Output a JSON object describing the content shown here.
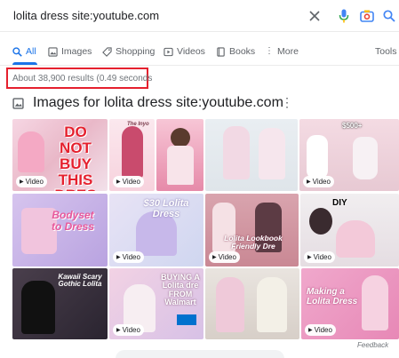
{
  "search": {
    "query": "lolita dress site:youtube.com"
  },
  "tabs": [
    {
      "label": "All",
      "icon": "search-icon",
      "active": true
    },
    {
      "label": "Images",
      "icon": "image-icon",
      "active": false
    },
    {
      "label": "Shopping",
      "icon": "tag-icon",
      "active": false
    },
    {
      "label": "Videos",
      "icon": "video-icon",
      "active": false
    },
    {
      "label": "Books",
      "icon": "book-icon",
      "active": false
    },
    {
      "label": "More",
      "icon": "kebab-icon",
      "active": false
    }
  ],
  "tools_label": "Tools",
  "result_stats": "About 38,900 results (0.49 seconds",
  "images_section": {
    "title": "Images for lolita dress site:youtube.com",
    "more_glyph": "⋮",
    "video_badge": "Video",
    "thumbnails": [
      {
        "text": "DO NOT BUY THIS DRES",
        "badge": true
      },
      {
        "text": "The Inyo",
        "badge": true
      },
      {
        "text": "",
        "badge": false
      },
      {
        "text": "",
        "badge": false
      },
      {
        "text": "$500+",
        "badge": true
      },
      {
        "text": "Bodyset to Dress",
        "badge": false
      },
      {
        "text": "$30 Lolita Dress",
        "badge": true
      },
      {
        "text": "Lolita Lookbook Friendly Dre",
        "badge": true
      },
      {
        "text": "DIY",
        "badge": true
      },
      {
        "text": "Kawaii Scary Gothic Lolita",
        "badge": false
      },
      {
        "text": "BUYING A Lolita dre FROM Walmart",
        "badge": true
      },
      {
        "text": "",
        "badge": false
      },
      {
        "text": "Making a Lolita Dress",
        "badge": true
      }
    ]
  },
  "feedback_label": "Feedback",
  "colors": {
    "accent": "#1a73e8",
    "highlight_box": "#e5202e"
  }
}
